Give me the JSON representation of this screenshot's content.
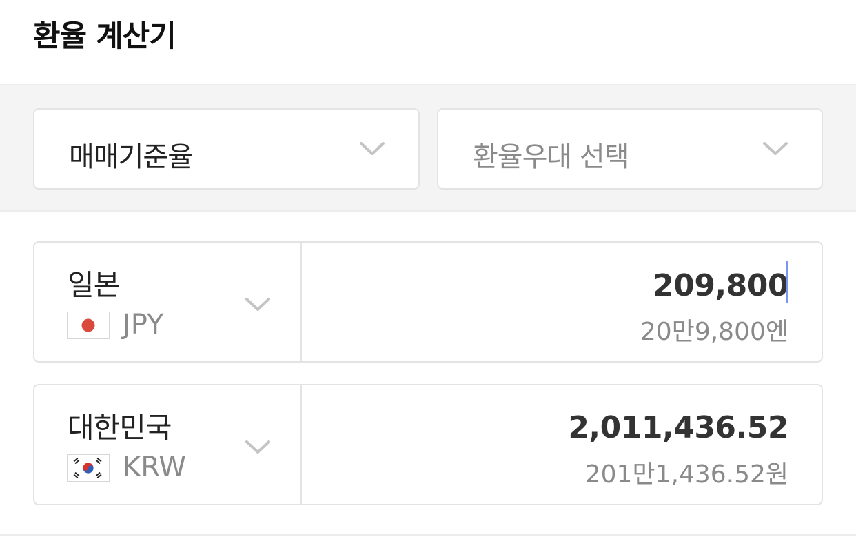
{
  "header": {
    "title": "환율 계산기"
  },
  "options": {
    "rate_type": {
      "selected": "매매기준율",
      "icon": "chevron-down-icon"
    },
    "preferential": {
      "placeholder": "환율우대 선택",
      "icon": "chevron-down-icon"
    }
  },
  "converter": {
    "from": {
      "country": "일본",
      "code": "JPY",
      "flag": "japan-flag-icon",
      "amount": "209,800",
      "amount_words": "20만9,800엔"
    },
    "to": {
      "country": "대한민국",
      "code": "KRW",
      "flag": "korea-flag-icon",
      "amount": "2,011,436.52",
      "amount_words": "201만1,436.52원"
    }
  },
  "colors": {
    "caret": "#7b96f0",
    "japan_red": "#d94a3d",
    "korea_red": "#d8322f",
    "korea_blue": "#2f5fb8",
    "border": "#e3e3e3",
    "band_bg": "#f4f4f4"
  }
}
